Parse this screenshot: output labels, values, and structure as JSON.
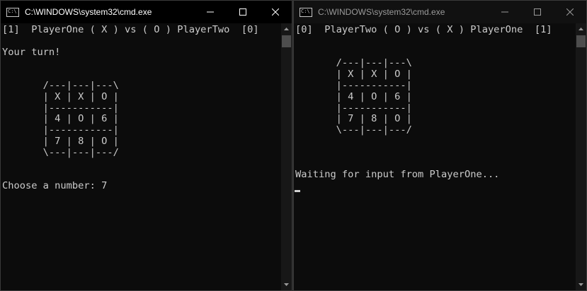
{
  "left_window": {
    "title": "C:\\WINDOWS\\system32\\cmd.exe",
    "icon_label": "C:\\",
    "console_text": "[1]  PlayerOne ( X ) vs ( O ) PlayerTwo  [0]\n\nYour turn!\n\n\n       /---|---|---\\\n       | X | X | O |\n       |-----------|\n       | 4 | O | 6 |\n       |-----------|\n       | 7 | 8 | O |\n       \\---|---|---/\n\n\nChoose a number: 7"
  },
  "right_window": {
    "title": "C:\\WINDOWS\\system32\\cmd.exe",
    "icon_label": "C:\\",
    "console_text": "[0]  PlayerTwo ( O ) vs ( X ) PlayerOne  [1]\n\n\n       /---|---|---\\\n       | X | X | O |\n       |-----------|\n       | 4 | O | 6 |\n       |-----------|\n       | 7 | 8 | O |\n       \\---|---|---/\n\n\n\nWaiting for input from PlayerOne..."
  }
}
